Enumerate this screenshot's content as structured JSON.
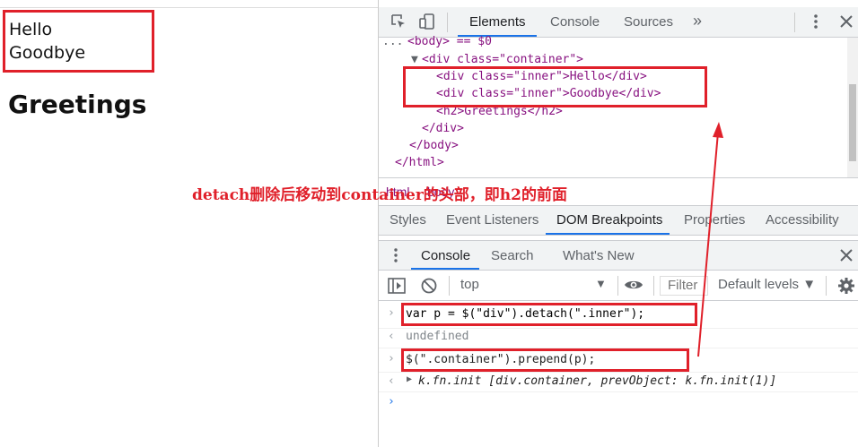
{
  "page": {
    "inner_divs": [
      "Hello",
      "Goodbye"
    ],
    "heading": "Greetings"
  },
  "devtools": {
    "tabs": [
      "Elements",
      "Console",
      "Sources"
    ],
    "more_tabs_glyph": "»",
    "dom": {
      "body_line": "<body> == $0",
      "container_open": "<div class=\"container\">",
      "inner1": "<div class=\"inner\">Hello</div>",
      "inner2": "<div class=\"inner\">Goodbye</div>",
      "h2": "<h2>Greetings</h2>",
      "div_close": "</div>",
      "body_close": "</body>",
      "html_close": "</html>"
    },
    "breadcrumb": [
      "html",
      "body"
    ],
    "sidebar_tabs": [
      "Styles",
      "Event Listeners",
      "DOM Breakpoints",
      "Properties",
      "Accessibility"
    ],
    "drawer_tabs": [
      "Console",
      "Search",
      "What's New"
    ],
    "console_toolbar": {
      "context": "top",
      "filter_placeholder": "Filter",
      "levels": "Default levels ▼"
    },
    "console": [
      {
        "type": "input",
        "text": "var p = $(\"div\").detach(\".inner\");"
      },
      {
        "type": "output",
        "text": "undefined"
      },
      {
        "type": "input",
        "text": "$(\".container\").prepend(p);"
      },
      {
        "type": "output",
        "text": "k.fn.init [div.container, prevObject: k.fn.init(1)]"
      }
    ]
  },
  "annotation": "detach删除后移动到container的头部，即h2的前面",
  "colors": {
    "highlight": "#e0202a",
    "accent": "#1a73e8"
  },
  "icons": [
    "inspect-element-icon",
    "device-toolbar-icon",
    "kebab-menu-icon",
    "close-icon",
    "sidebar-toggle-icon",
    "clear-console-icon",
    "eye-icon",
    "gear-icon"
  ]
}
